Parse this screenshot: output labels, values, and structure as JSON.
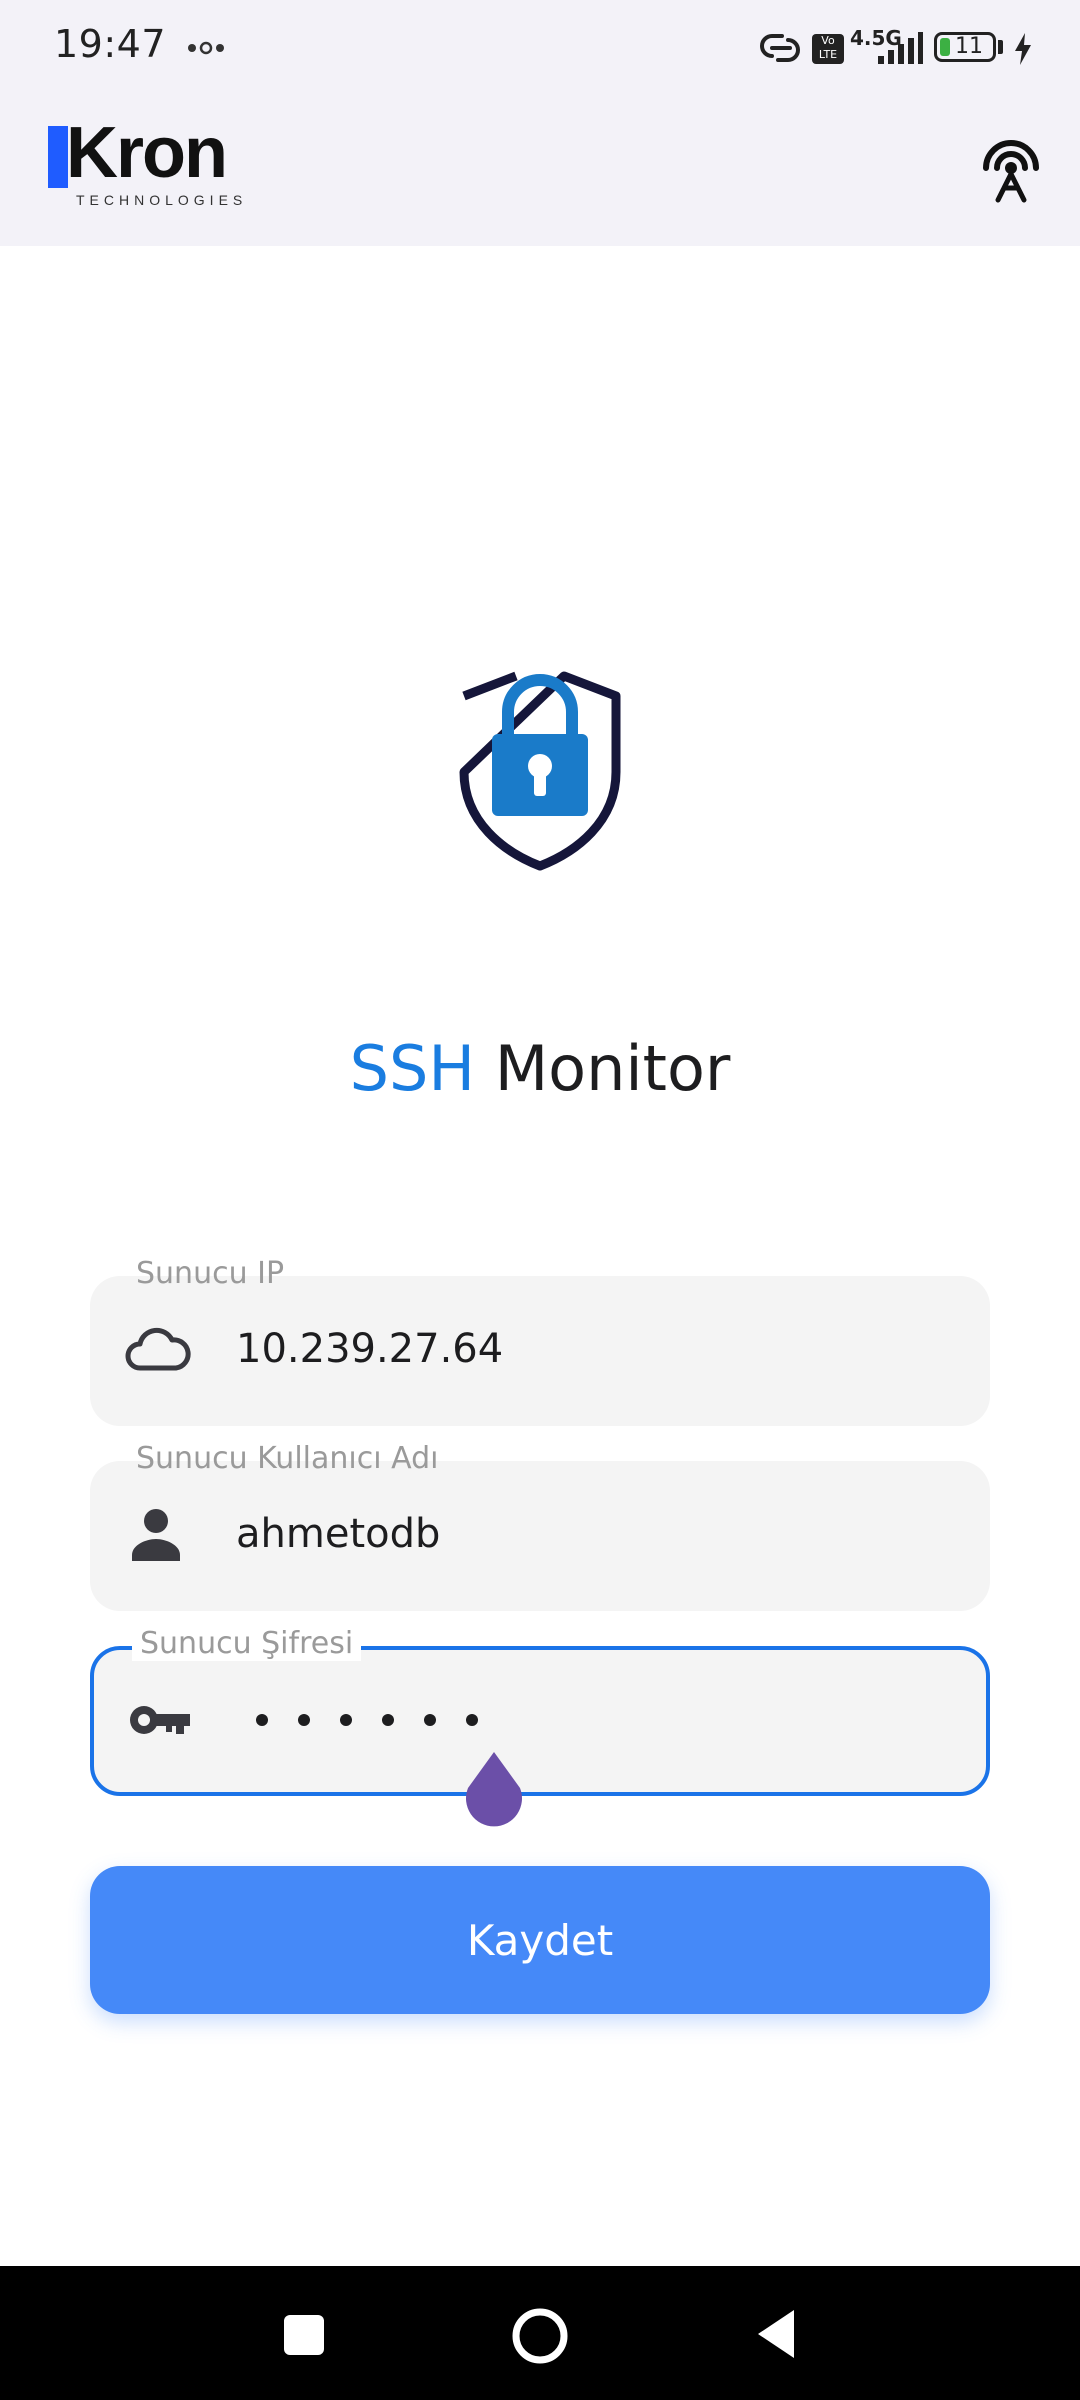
{
  "status_bar": {
    "time": "19:47",
    "network": "4.5G",
    "volte": "Vo LTE",
    "battery": "11"
  },
  "app_bar": {
    "logo_text": "Kron",
    "logo_subtext": "TECHNOLOGIES",
    "action_icon": "antenna-icon"
  },
  "hero": {
    "icon": "shield-lock-icon",
    "title_accent": "SSH",
    "title_rest": "Monitor"
  },
  "form": {
    "server_ip": {
      "label": "Sunucu IP",
      "value": "10.239.27.64",
      "icon": "cloud-icon"
    },
    "server_username": {
      "label": "Sunucu Kullanıcı Adı",
      "value": "ahmetodb",
      "icon": "person-icon"
    },
    "server_password": {
      "label": "Sunucu Şifresi",
      "masked_length": 6,
      "icon": "key-icon"
    },
    "save_label": "Kaydet"
  },
  "colors": {
    "accent": "#1a7de0",
    "button": "#4589f8",
    "focus_border": "#1a73e8",
    "cursor_handle": "#6b4fa8"
  }
}
